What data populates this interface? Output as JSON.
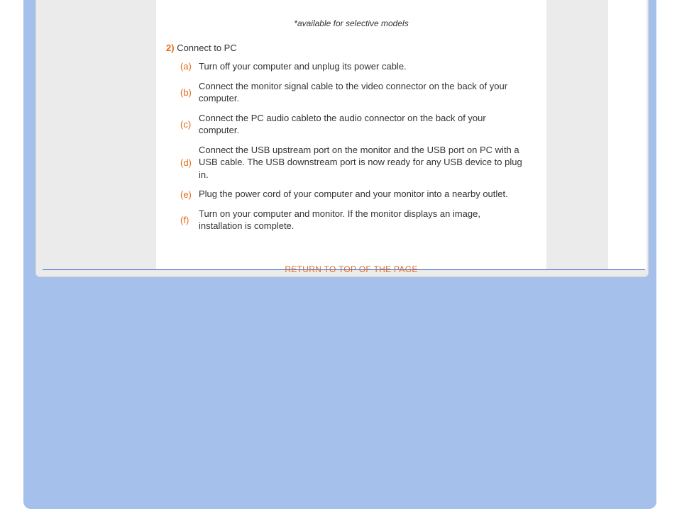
{
  "note": "*available for selective models",
  "step": {
    "number": "2)",
    "title": "Connect to PC"
  },
  "substeps": [
    {
      "letter": "(a)",
      "text": "Turn off your computer and unplug its power cable."
    },
    {
      "letter": "(b)",
      "text": "Connect the monitor signal cable to the video connector on the back of your computer."
    },
    {
      "letter": "(c)",
      "text": "Connect the PC audio cableto the audio connector on the back of your computer."
    },
    {
      "letter": "(d)",
      "text": "Connect the USB upstream port on the monitor and the USB port on PC with a USB cable. The USB downstream port is now ready for any USB device to plug in."
    },
    {
      "letter": "(e)",
      "text": "Plug the power cord of your computer and your monitor into a nearby outlet."
    },
    {
      "letter": "(f)",
      "text": "Turn on your computer and monitor. If the monitor displays an image, installation is complete."
    }
  ],
  "returnLink": "RETURN TO TOP OF THE PAGE"
}
